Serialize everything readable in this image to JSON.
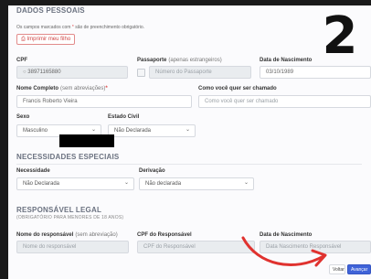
{
  "header": {
    "section_title": "DADOS PESSOAIS",
    "required_note_prefix": "Os campos marcados com ",
    "required_star": "*",
    "required_note_suffix": " são de preenchimento obrigatório.",
    "print_button": "Imprimir meu filho"
  },
  "badge": {
    "number": "2"
  },
  "row1": {
    "cpf_label": "CPF",
    "cpf_value": "38971165880",
    "passport_label": "Passaporte",
    "passport_hint": "(apenas estrangeiros)",
    "passport_placeholder": "Número do Passaporte",
    "birth_label": "Data de Nascimento",
    "birth_value": "03/10/1989"
  },
  "row2": {
    "name_label": "Nome Completo",
    "name_hint": "(sem abreviações)",
    "name_value": "Francis Roberto Vieira",
    "nickname_label": "Como você quer ser chamado",
    "nickname_placeholder": "Como você quer ser chamado"
  },
  "row3": {
    "sex_label": "Sexo",
    "sex_value": "Masculino",
    "civil_label": "Estado Civil",
    "civil_value": "Não Declarada"
  },
  "special": {
    "title": "NECESSIDADES ESPECIAIS",
    "need_label": "Necessidade",
    "need_value": "Não Declarada",
    "derivation_label": "Derivação",
    "derivation_value": "Não declarada"
  },
  "guardian": {
    "title": "RESPONSÁVEL LEGAL",
    "subtitle": "(OBRIGATÓRIO PARA MENORES DE 18 ANOS)",
    "name_label": "Nome do responsável",
    "name_hint": "(sem abreviação)",
    "name_placeholder": "Nome do responsável",
    "cpf_label": "CPF do Responsável",
    "cpf_placeholder": "CPF do Responsável",
    "birth_label": "Data de Nascimento",
    "birth_placeholder": "Data Nascimento Responsável"
  },
  "footer": {
    "back_button": "Voltar",
    "next_button": "Avançar"
  },
  "colors": {
    "accent": "#3f63d8",
    "danger": "#d04848",
    "arrow": "#e0322f"
  }
}
